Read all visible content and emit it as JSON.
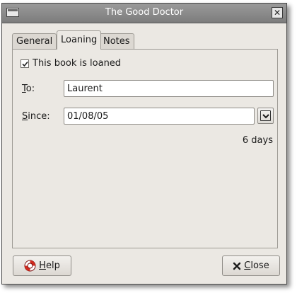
{
  "window": {
    "title": "The Good Doctor"
  },
  "tabs": [
    {
      "label": "General",
      "active": false
    },
    {
      "label": "Loaning",
      "active": true
    },
    {
      "label": "Notes",
      "active": false
    }
  ],
  "loaning": {
    "loaned_checkbox_label": "This book is loaned",
    "loaned_checked": true,
    "to_label": "To:",
    "to_value": "Laurent",
    "since_label": "Since:",
    "since_value": "01/08/05",
    "duration_text": "6 days"
  },
  "buttons": {
    "help_label": "Help",
    "close_label": "Close"
  },
  "icons": {
    "window_menu": "window-menu-icon",
    "window_close": "close-icon",
    "help": "lifebuoy-icon",
    "close": "x-icon",
    "date_dropdown": "chevron-down-icon"
  }
}
